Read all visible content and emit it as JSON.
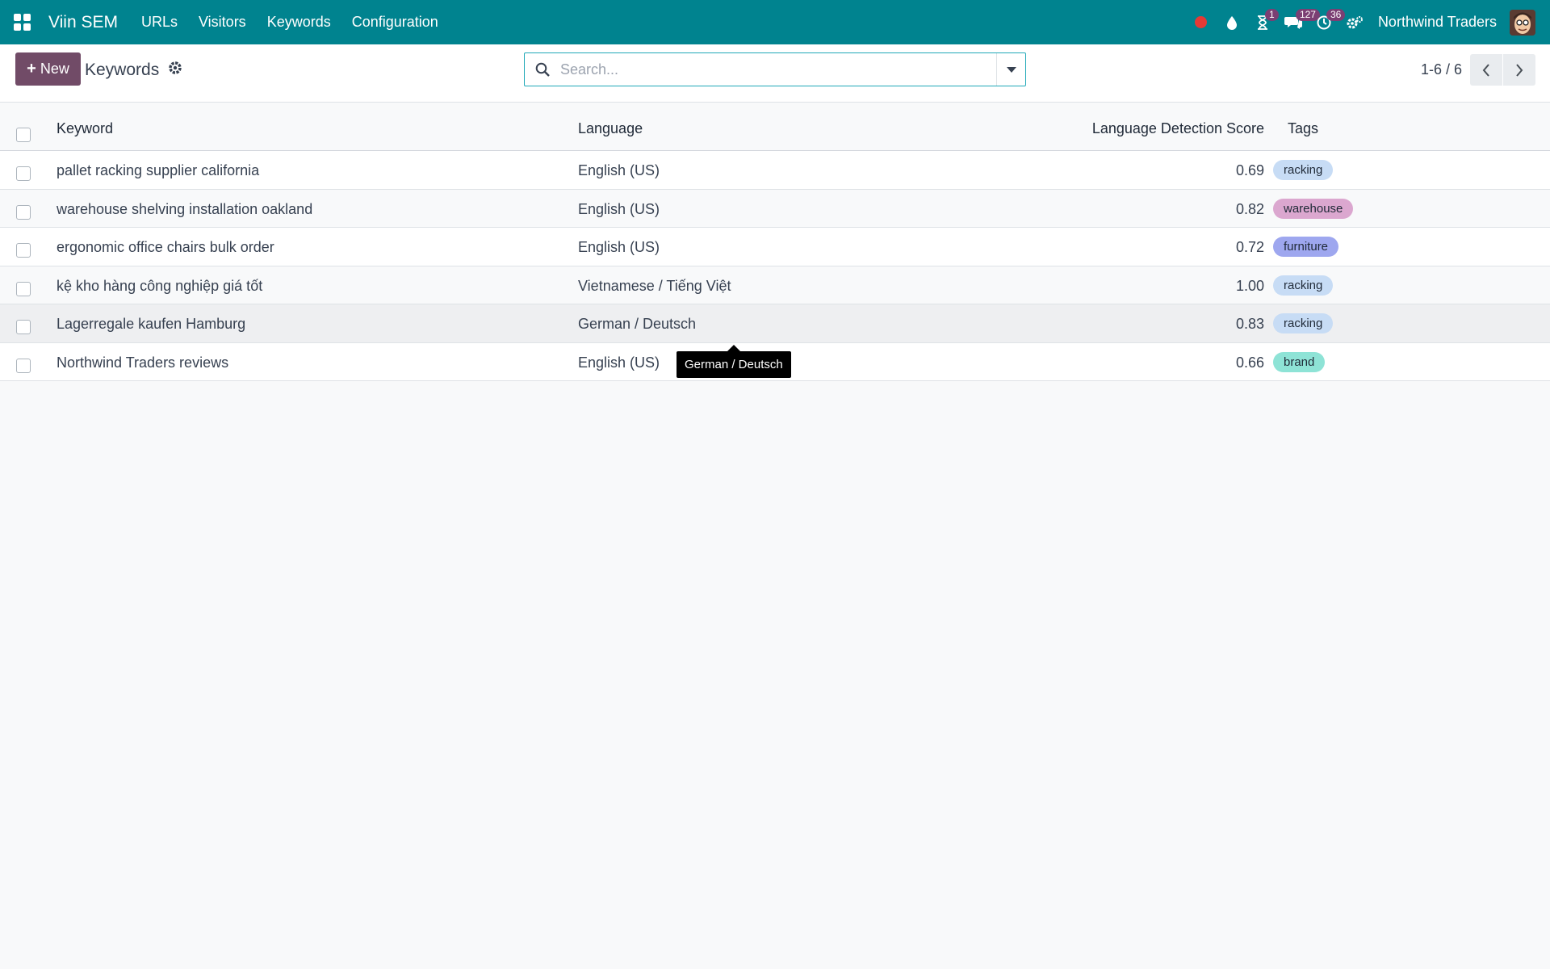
{
  "navbar": {
    "brand": "Viin SEM",
    "menu": [
      "URLs",
      "Visitors",
      "Keywords",
      "Configuration"
    ],
    "badges": {
      "activities": "1",
      "messages": "127",
      "timer": "36"
    },
    "company": "Northwind Traders",
    "icons": [
      "apps-icon",
      "recording-dot-icon",
      "drop-icon",
      "hourglass-icon",
      "chat-icon",
      "clock-icon",
      "settings-icon"
    ],
    "colors": {
      "bar": "#00838f",
      "badge": "#7b3f73",
      "record_dot": "#e53935"
    }
  },
  "control_panel": {
    "new_label": "New",
    "title": "Keywords",
    "search_placeholder": "Search...",
    "pager": "1-6 / 6"
  },
  "table": {
    "headers": {
      "keyword": "Keyword",
      "language": "Language",
      "score": "Language Detection Score",
      "tags": "Tags"
    },
    "rows": [
      {
        "keyword": "pallet racking supplier california",
        "language": "English (US)",
        "score": "0.69",
        "tag": "racking",
        "tag_color": "#c7dcf5"
      },
      {
        "keyword": "warehouse shelving installation oakland",
        "language": "English (US)",
        "score": "0.82",
        "tag": "warehouse",
        "tag_color": "#dba7cf"
      },
      {
        "keyword": "ergonomic office chairs bulk order",
        "language": "English (US)",
        "score": "0.72",
        "tag": "furniture",
        "tag_color": "#9ea7ef"
      },
      {
        "keyword": "kệ kho hàng công nghiệp giá tốt",
        "language": "Vietnamese / Tiếng Việt",
        "score": "1.00",
        "tag": "racking",
        "tag_color": "#c7dcf5"
      },
      {
        "keyword": "Lagerregale kaufen Hamburg",
        "language": "German / Deutsch",
        "score": "0.83",
        "tag": "racking",
        "tag_color": "#c7dcf5"
      },
      {
        "keyword": "Northwind Traders reviews",
        "language": "English (US)",
        "score": "0.66",
        "tag": "brand",
        "tag_color": "#8ee3d6"
      }
    ]
  },
  "tooltip": {
    "text": "German / Deutsch"
  }
}
